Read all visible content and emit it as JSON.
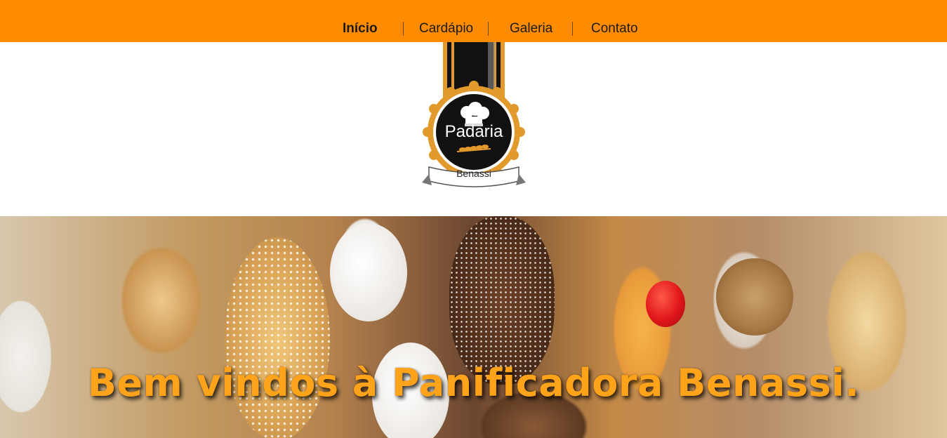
{
  "nav": {
    "items": [
      {
        "label": "Início",
        "active": true
      },
      {
        "label": "Cardápio",
        "active": false
      },
      {
        "label": "Galeria",
        "active": false
      },
      {
        "label": "Contato",
        "active": false
      }
    ]
  },
  "logo": {
    "title": "Padaria",
    "subtitle": "Benassi"
  },
  "hero": {
    "title": "Bem vindos à Panificadora Benassi."
  },
  "colors": {
    "topbar": "#ff8c00",
    "hero_title": "#ffa31a",
    "logo_ring": "#e39a2c",
    "logo_dark": "#111111"
  }
}
